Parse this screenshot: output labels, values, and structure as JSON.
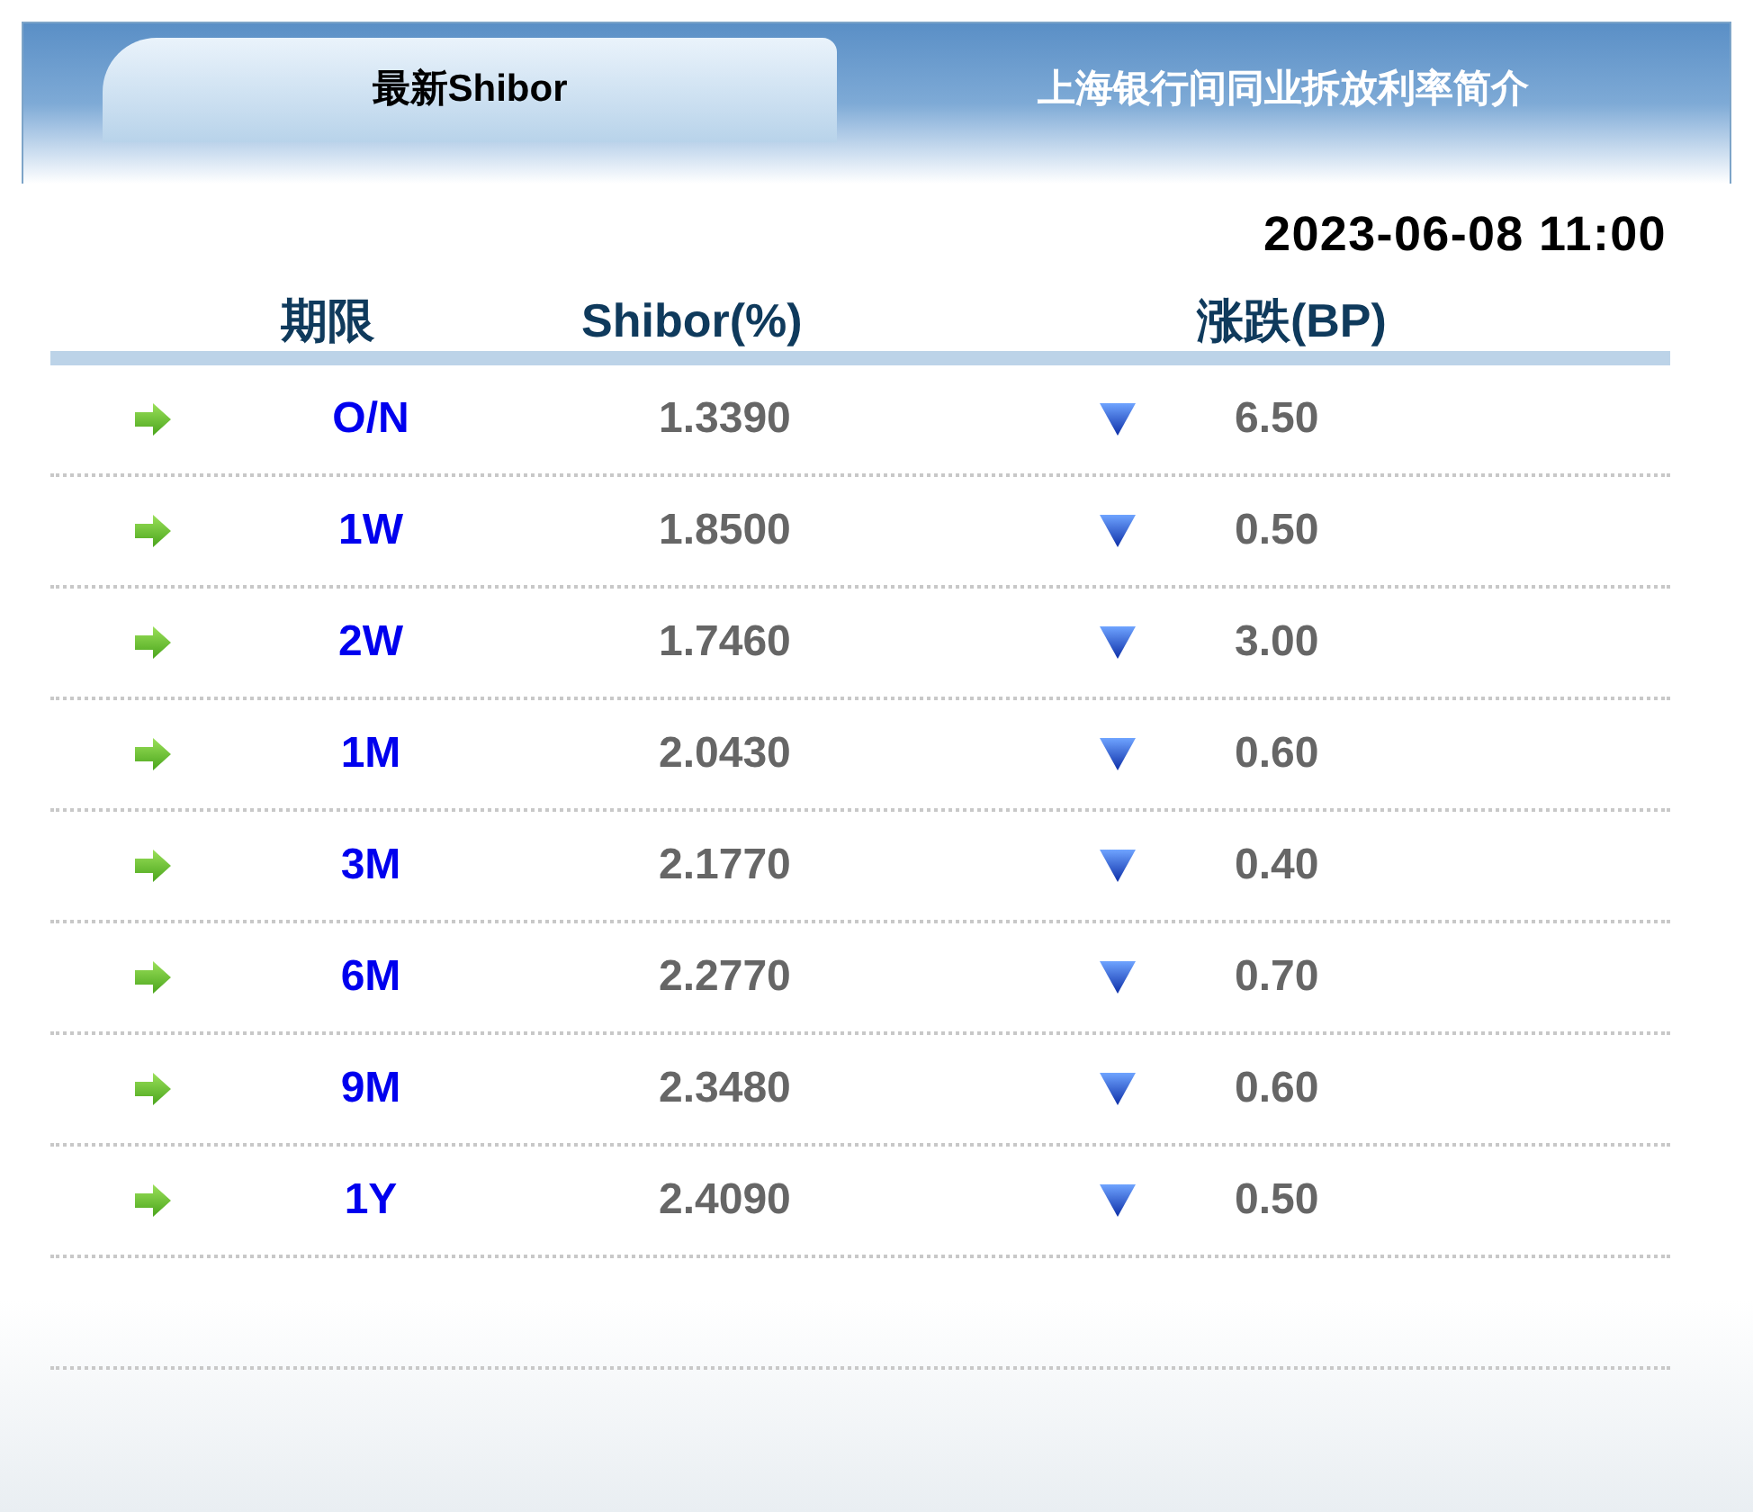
{
  "tabs": [
    {
      "label": "最新Shibor",
      "selected": true
    },
    {
      "label": "上海银行间同业拆放利率简介",
      "selected": false
    }
  ],
  "timestamp": "2023-06-08 11:00",
  "table": {
    "columns": [
      "期限",
      "Shibor(%)",
      "涨跌(BP)"
    ],
    "rows": [
      {
        "term": "O/N",
        "rate": "1.3390",
        "falling": true,
        "change": "6.50"
      },
      {
        "term": "1W",
        "rate": "1.8500",
        "falling": true,
        "change": "0.50"
      },
      {
        "term": "2W",
        "rate": "1.7460",
        "falling": true,
        "change": "3.00"
      },
      {
        "term": "1M",
        "rate": "2.0430",
        "falling": true,
        "change": "0.60"
      },
      {
        "term": "3M",
        "rate": "2.1770",
        "falling": true,
        "change": "0.40"
      },
      {
        "term": "6M",
        "rate": "2.2770",
        "falling": true,
        "change": "0.70"
      },
      {
        "term": "9M",
        "rate": "2.3480",
        "falling": true,
        "change": "0.60"
      },
      {
        "term": "1Y",
        "rate": "2.4090",
        "falling": true,
        "change": "0.50"
      }
    ]
  }
}
